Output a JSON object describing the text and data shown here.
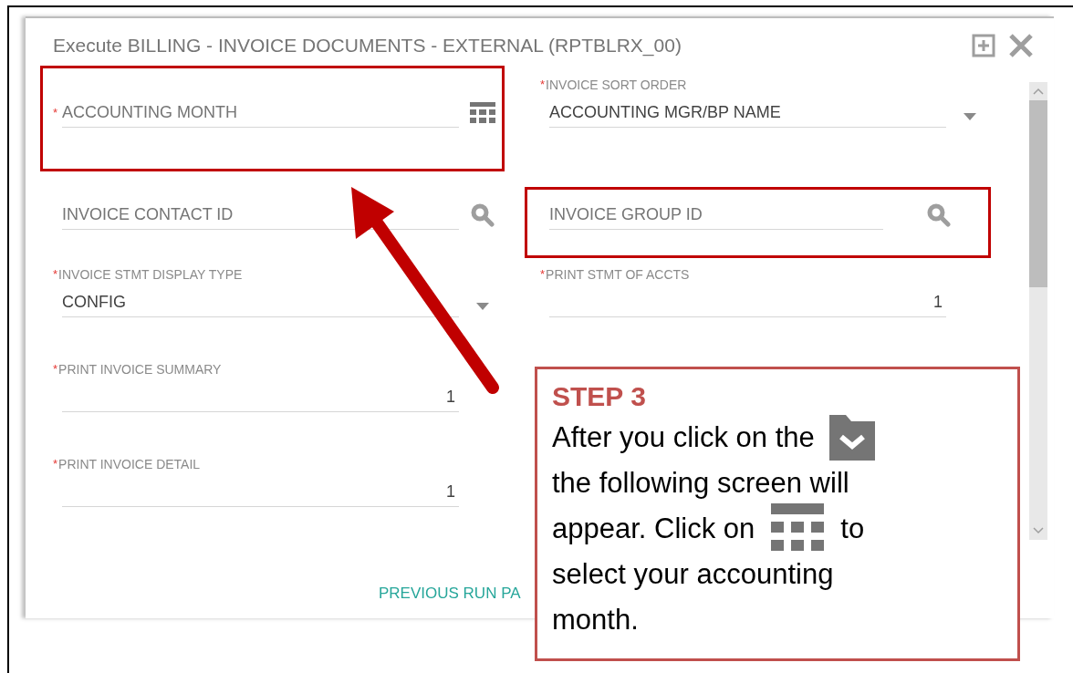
{
  "dialog": {
    "title": "Execute BILLING - INVOICE DOCUMENTS - EXTERNAL (RPTBLRX_00)"
  },
  "fields": [
    {
      "kind": "date",
      "mark": "*",
      "placeholder": "ACCOUNTING MONTH",
      "highlighted": true
    },
    {
      "kind": "select",
      "mark": "*",
      "label": "INVOICE SORT ORDER",
      "value": "ACCOUNTING MGR/BP NAME",
      "highlighted": false
    },
    {
      "kind": "lookup",
      "placeholder": "INVOICE CONTACT ID",
      "highlighted": false
    },
    {
      "kind": "lookup",
      "placeholder": "INVOICE GROUP ID",
      "highlighted": true
    },
    {
      "kind": "select",
      "mark": "*",
      "label": "INVOICE STMT DISPLAY TYPE",
      "value": "CONFIG",
      "highlighted": false
    },
    {
      "kind": "number",
      "mark": "*",
      "label": "PRINT STMT OF ACCTS",
      "value": "1",
      "highlighted": false
    },
    {
      "kind": "number",
      "mark": "*",
      "label": "PRINT INVOICE SUMMARY",
      "value": "1",
      "highlighted": false
    },
    {
      "kind": "none"
    },
    {
      "kind": "number",
      "mark": "*",
      "label": "PRINT INVOICE DETAIL",
      "value": "1",
      "highlighted": false
    }
  ],
  "footer_link": "PREVIOUS RUN PA",
  "callout": {
    "heading": "STEP 3",
    "lines": [
      [
        {
          "kind": "text",
          "text": "After you click on the"
        },
        {
          "kind": "folder-icon"
        }
      ],
      [
        {
          "kind": "text",
          "text": "the following screen will"
        }
      ],
      [
        {
          "kind": "text",
          "text": "appear. Click on"
        },
        {
          "kind": "calendar-icon"
        },
        {
          "kind": "text",
          "text": "to"
        }
      ],
      [
        {
          "kind": "text",
          "text": "select your accounting"
        }
      ],
      [
        {
          "kind": "text",
          "text": "month."
        }
      ]
    ]
  }
}
